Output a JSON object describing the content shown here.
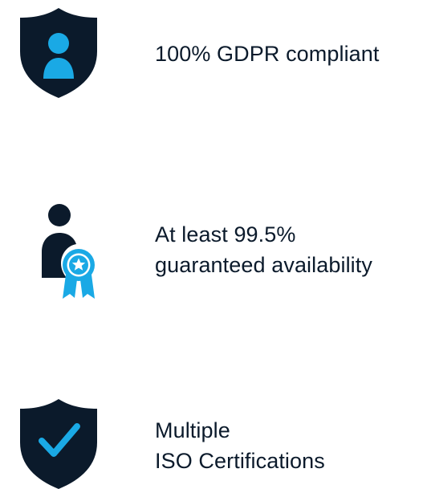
{
  "features": [
    {
      "icon": "shield-user-icon",
      "lines": [
        "100% GDPR compliant"
      ]
    },
    {
      "icon": "user-award-ribbon-icon",
      "lines": [
        "At least 99.5%",
        "guaranteed availability"
      ]
    },
    {
      "icon": "shield-check-icon",
      "lines": [
        "Multiple",
        "ISO Certifications"
      ]
    }
  ],
  "colors": {
    "navy": "#0b1a2b",
    "accent": "#1aa9e5",
    "background": "#ffffff"
  }
}
